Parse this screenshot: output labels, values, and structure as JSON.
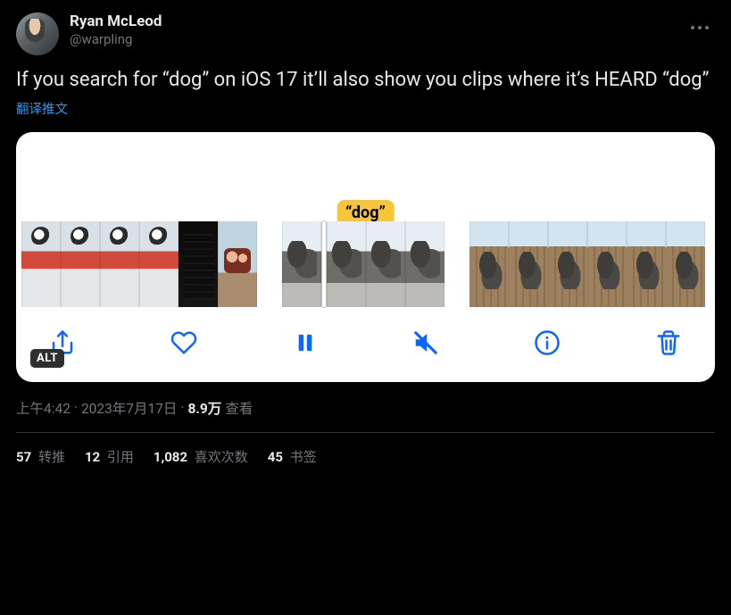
{
  "author": {
    "display_name": "Ryan McLeod",
    "handle": "@warpling"
  },
  "tweet_text": "If you search for “dog” on iOS 17 it’ll also show you clips where it’s HEARD “dog”",
  "translate_label": "翻译推文",
  "media": {
    "search_tag": "“dog”",
    "alt_badge": "ALT",
    "toolbar_icons": {
      "share": "share-icon",
      "like": "heart-icon",
      "pause": "pause-icon",
      "mute": "speaker-muted-icon",
      "info": "info-icon",
      "delete": "trash-icon"
    }
  },
  "meta": {
    "time": "上午4:42",
    "dot1": " · ",
    "date": "2023年7月17日",
    "dot2": " · ",
    "views_count": "8.9万",
    "views_label": " 查看"
  },
  "stats": {
    "retweets": {
      "count": "57",
      "label": " 转推"
    },
    "quotes": {
      "count": "12",
      "label": " 引用"
    },
    "likes": {
      "count": "1,082",
      "label": " 喜欢次数"
    },
    "bookmarks": {
      "count": "45",
      "label": " 书签"
    }
  }
}
